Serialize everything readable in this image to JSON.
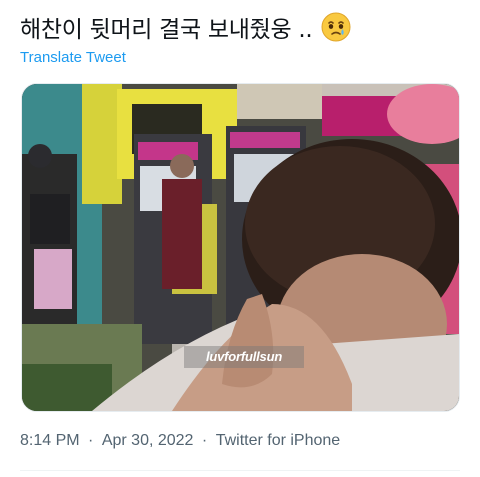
{
  "tweet": {
    "text": "해찬이 뒷머리 결국 보내줬웅 ..",
    "emoji": "face-holding-back-tears",
    "translate_label": "Translate Tweet"
  },
  "media": {
    "watermark_text": "luvforfullsun",
    "description_icon": "photo"
  },
  "meta": {
    "time": "8:14 PM",
    "date": "Apr 30, 2022",
    "source": "Twitter for iPhone",
    "separator": "·"
  },
  "colors": {
    "text": "#0f1419",
    "link": "#1d9bf0",
    "muted": "#536471"
  }
}
